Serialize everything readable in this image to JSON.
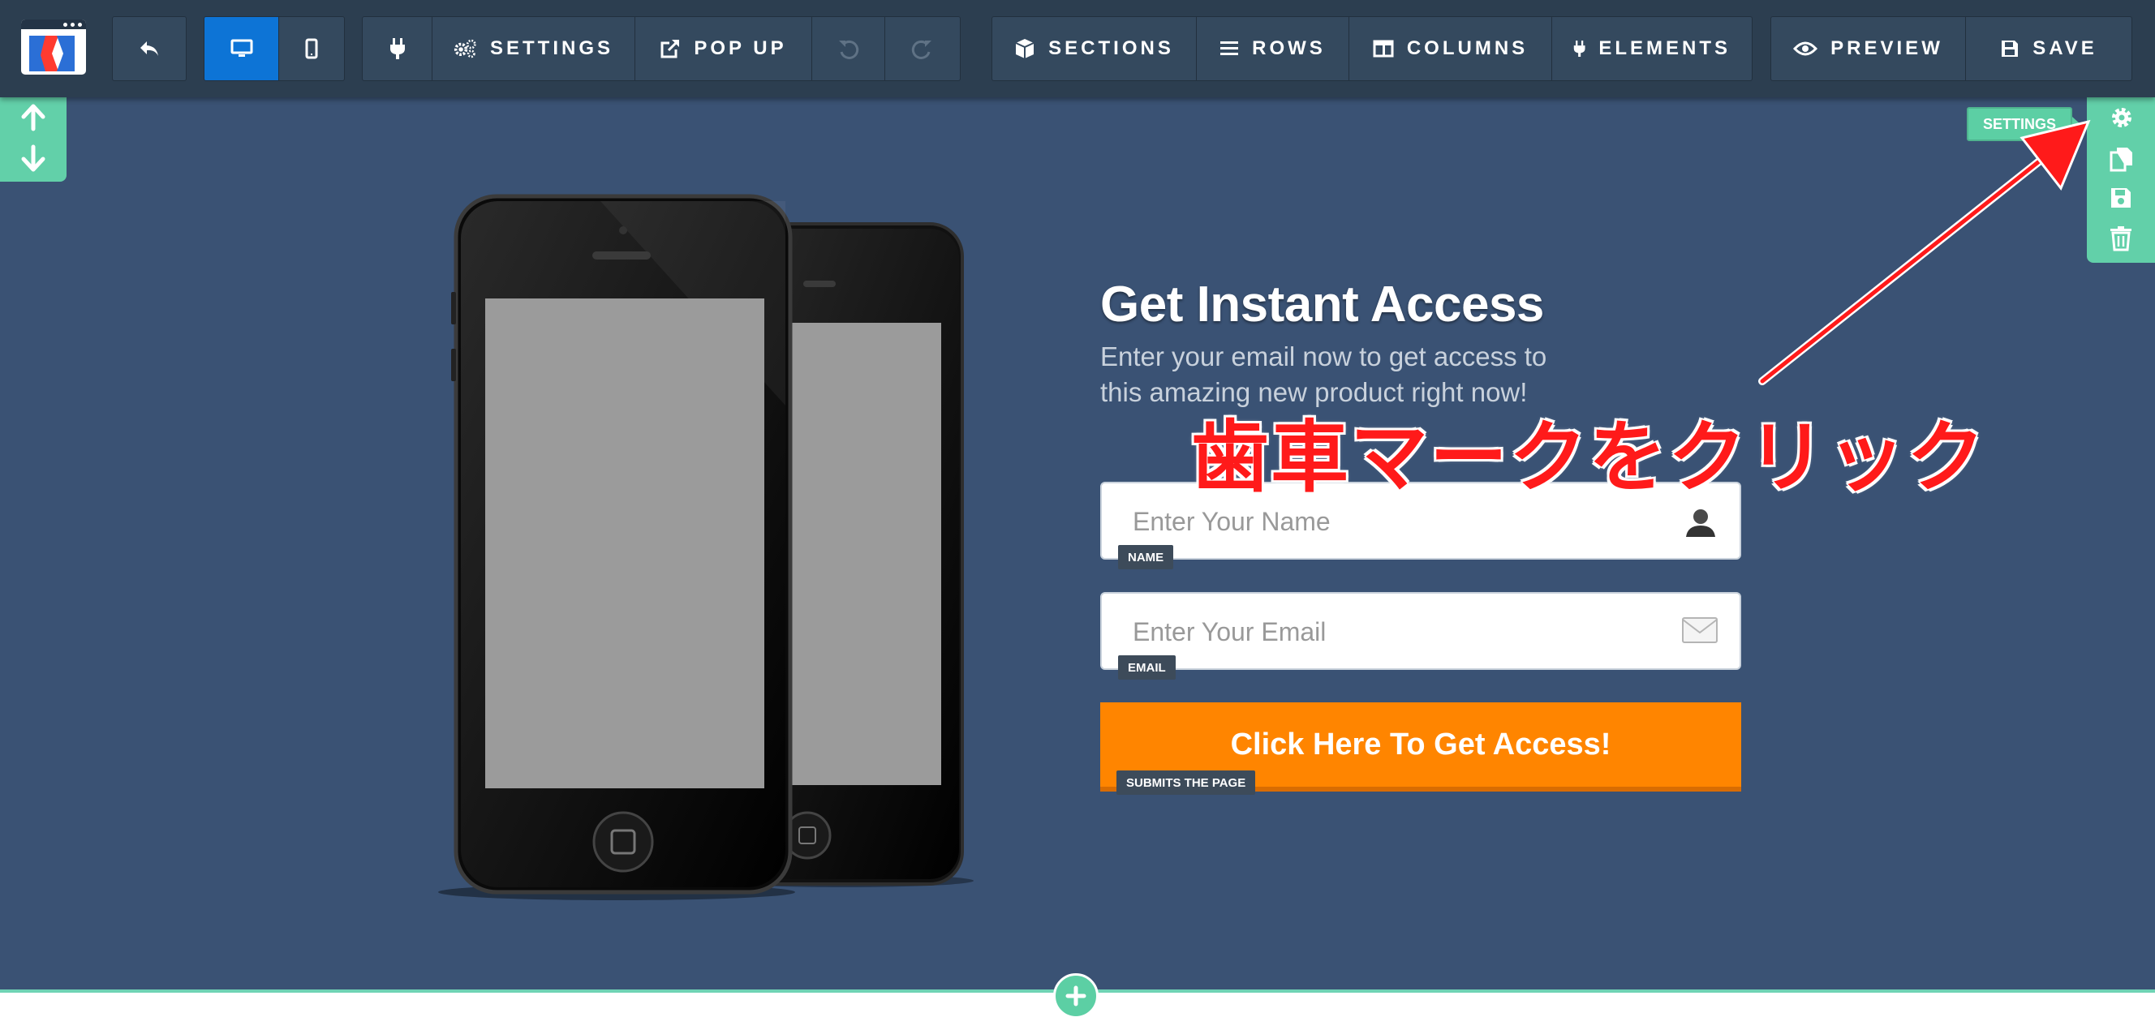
{
  "toolbar": {
    "settings_label": "SETTINGS",
    "popup_label": "POP UP",
    "sections_label": "SECTIONS",
    "rows_label": "ROWS",
    "columns_label": "COLUMNS",
    "elements_label": "ELEMENTS",
    "preview_label": "PREVIEW",
    "save_label": "SAVE"
  },
  "section_tools": {
    "tooltip": "SETTINGS"
  },
  "content": {
    "headline": "Get Instant Access",
    "subtext": "Enter your email now to get access to this amazing new product right now!"
  },
  "form": {
    "name_placeholder": "Enter Your Name",
    "name_tag": "NAME",
    "email_placeholder": "Enter Your Email",
    "email_tag": "EMAIL",
    "submit_label": "Click Here To Get Access!",
    "submit_tag": "SUBMITS THE PAGE"
  },
  "annotation": {
    "text": "歯車マークをクリック",
    "color": "#ff1a1a"
  },
  "colors": {
    "toolbar_bg": "#2c3e50",
    "section_bg": "#3a5274",
    "accent_green": "#62d0a9",
    "active_blue": "#0d74d6",
    "submit_orange": "#ff8500"
  }
}
